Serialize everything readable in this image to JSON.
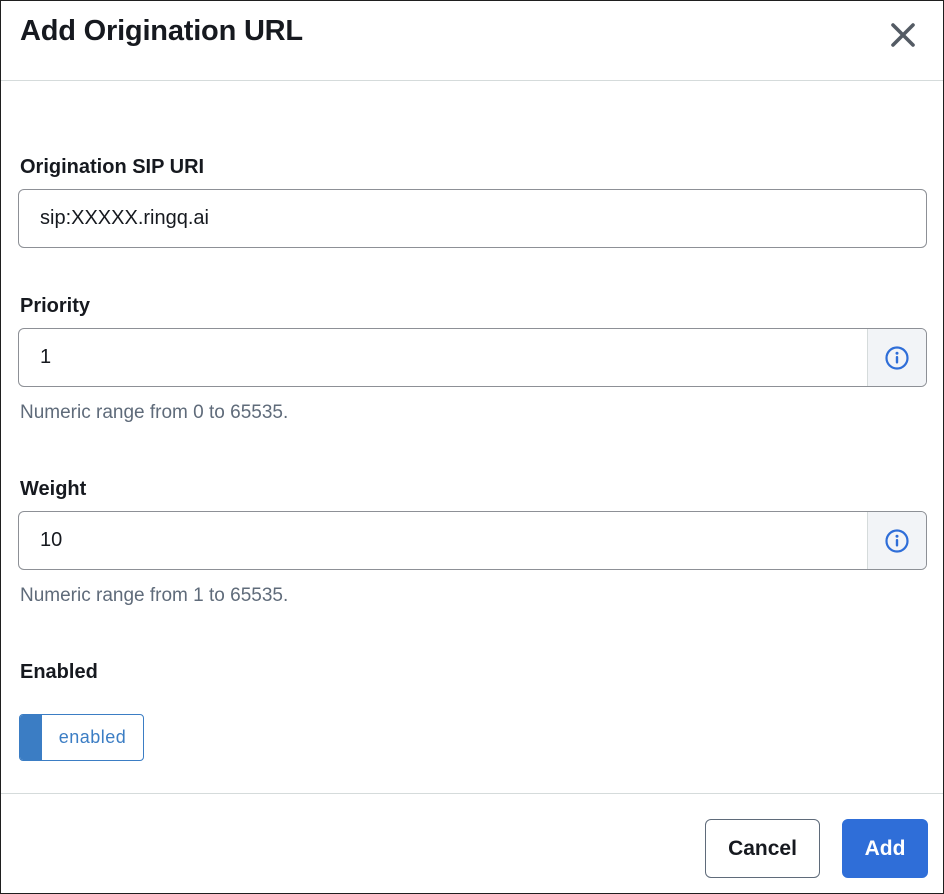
{
  "dialog": {
    "title": "Add Origination URL"
  },
  "fields": {
    "sip_uri": {
      "label": "Origination SIP URI",
      "value": "sip:XXXXX.ringq.ai"
    },
    "priority": {
      "label": "Priority",
      "value": "1",
      "hint": "Numeric range from 0 to 65535."
    },
    "weight": {
      "label": "Weight",
      "value": "10",
      "hint": "Numeric range from 1 to 65535."
    },
    "enabled": {
      "label": "Enabled",
      "toggle_label": "enabled"
    }
  },
  "footer": {
    "cancel_label": "Cancel",
    "add_label": "Add"
  },
  "colors": {
    "primary": "#2f6ed8",
    "toggle_accent": "#3b7dc4",
    "hint_text": "#5f6b7a"
  },
  "icons": {
    "close": "close-icon",
    "info": "info-icon"
  }
}
